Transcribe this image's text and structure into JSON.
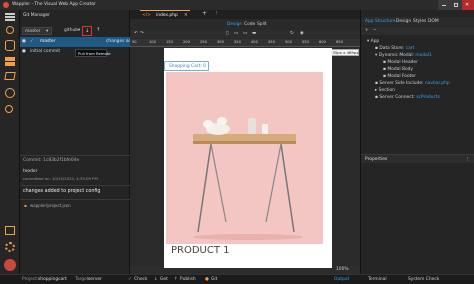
{
  "app": {
    "title": "Wappler - The Visual Web App Creator"
  },
  "left_icons": [
    "hamburger-menu-icon",
    "git-icon",
    "database-icon",
    "server-icon",
    "layers-icon",
    "globe-icon",
    "search-icon"
  ],
  "left_bottom_icons": [
    "pages-icon",
    "settings-icon",
    "user-avatar-icon"
  ],
  "git": {
    "title": "Git Manager",
    "branch": "master",
    "remote": "github",
    "tooltip": "Pull from Remote",
    "changes_item": "changes added...",
    "sub_item_1": "master",
    "sub_item_2": "initial commit",
    "commit_hash": "Commit: 1c83b2f1bfe04e",
    "commit_author": "teodor",
    "commit_date": "committed on: 10/15/2020, 4:35:09 PM",
    "commit_message": "changes added to project config",
    "file": "wappler/project.json"
  },
  "tabs": [
    {
      "label": "index.php",
      "active": true
    }
  ],
  "view_modes": [
    "Design",
    "Code",
    "Split"
  ],
  "toolbar_top_right": [
    "App Structure",
    "Design",
    "Styles",
    "DOM"
  ],
  "ruler_ticks": [
    "50",
    "100",
    "150",
    "200",
    "250",
    "300",
    "350",
    "400",
    "450",
    "500",
    "550",
    "600",
    "650"
  ],
  "size_badge": "735px x 469px",
  "page": {
    "cart_button": "Shopping Cart: 0",
    "product_title": "PRODUCT 1"
  },
  "zoom": "100%",
  "structure": {
    "root": "App",
    "items": [
      {
        "label": "Data Store: ",
        "value": "cart",
        "indent": 1
      },
      {
        "label": "Dynamic Modal: ",
        "value": "modal1",
        "indent": 1
      },
      {
        "label": "Modal Header",
        "value": "",
        "indent": 2
      },
      {
        "label": "Modal Body",
        "value": "",
        "indent": 2
      },
      {
        "label": "Modal Footer",
        "value": "",
        "indent": 2
      },
      {
        "label": "Server Side Include: ",
        "value": "navbar.php",
        "indent": 1
      },
      {
        "label": "Section",
        "value": "",
        "indent": 1
      },
      {
        "label": "Server Connect: ",
        "value": "scProducts",
        "indent": 1
      }
    ]
  },
  "properties_title": "Properties",
  "status": {
    "project_label": "Project:",
    "project": "shoppingcart",
    "target_label": "Target:",
    "target": "server",
    "check": "Check",
    "get": "Get",
    "publish": "Publish",
    "git": "Git",
    "output": "Output",
    "terminal": "Terminal",
    "system_check": "System Check"
  },
  "colors": {
    "accent": "#f29f4a",
    "selection": "#1f5a86",
    "link": "#3aa0f3",
    "photo_bg": "#f3c6c3"
  }
}
